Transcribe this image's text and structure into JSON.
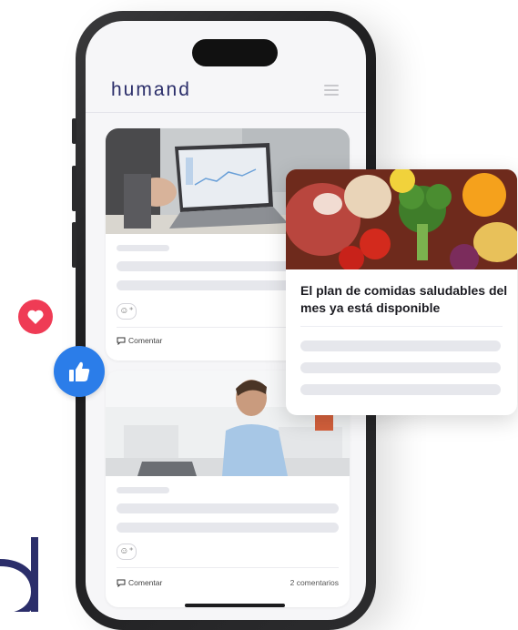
{
  "app": {
    "logo": "humand"
  },
  "posts": [
    {
      "comment_label": "Comentar",
      "comments_count": "2 c"
    },
    {
      "comment_label": "Comentar",
      "comments_count": "2 comentarios"
    }
  ],
  "featured": {
    "title": "El plan de comidas saludables del mes ya está disponible"
  },
  "reactions": {
    "heart": "heart-icon",
    "like": "thumbs-up-icon"
  },
  "colors": {
    "brand": "#2b2e6a",
    "heart": "#ef3b55",
    "like": "#2b7de9"
  }
}
